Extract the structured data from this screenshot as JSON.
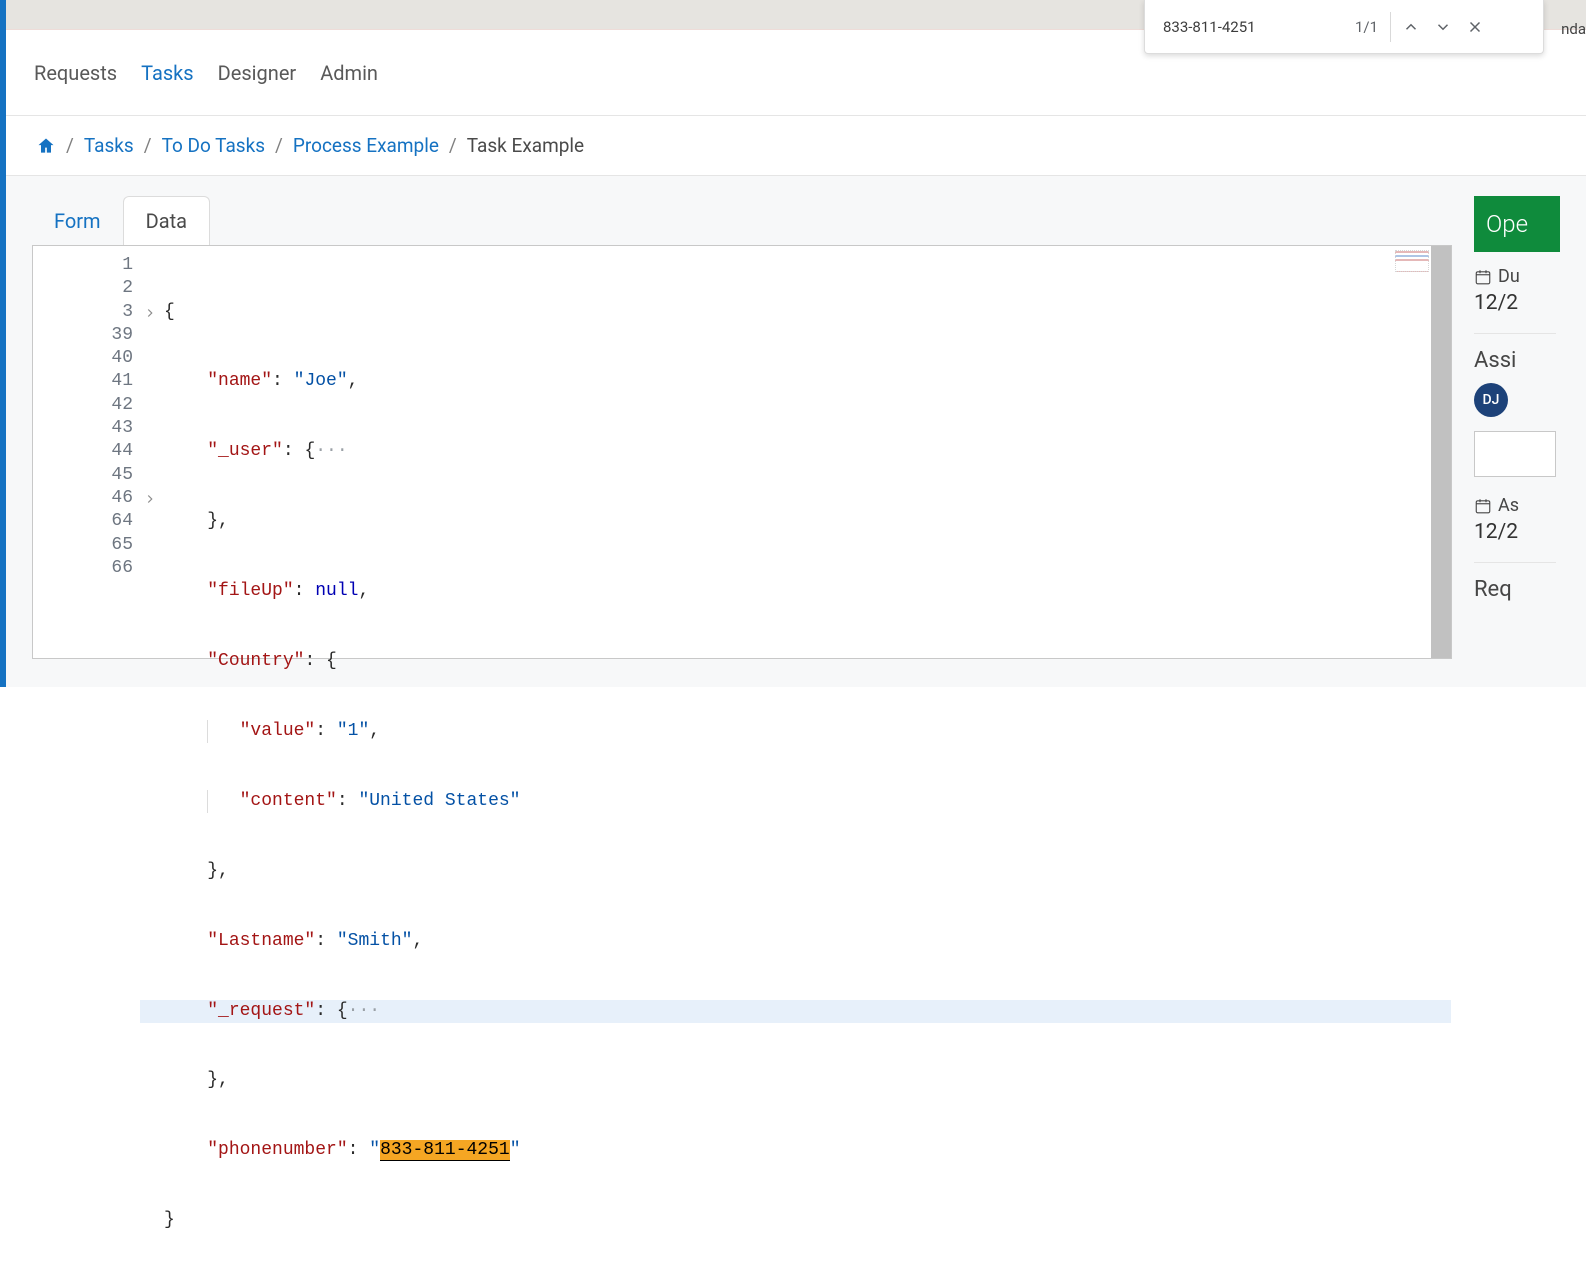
{
  "find": {
    "query": "833-811-4251",
    "count": "1/1"
  },
  "nav": {
    "requests": "Requests",
    "tasks": "Tasks",
    "designer": "Designer",
    "admin": "Admin"
  },
  "page_hint": "nda",
  "breadcrumb": {
    "tasks": "Tasks",
    "todo": "To Do Tasks",
    "process": "Process Example",
    "current": "Task Example"
  },
  "tabs": {
    "form": "Form",
    "data": "Data"
  },
  "code": {
    "lines": [
      "1",
      "2",
      "3",
      "39",
      "40",
      "41",
      "42",
      "43",
      "44",
      "45",
      "46",
      "64",
      "65",
      "66"
    ],
    "fold_line_indexes": [
      2,
      10
    ],
    "rows": {
      "r1": "{",
      "name_key": "\"name\"",
      "name_val": "\"Joe\"",
      "user_key": "\"_user\"",
      "fileup_key": "\"fileUp\"",
      "fileup_val": "null",
      "country_key": "\"Country\"",
      "value_key": "\"value\"",
      "value_val": "\"1\"",
      "content_key": "\"content\"",
      "content_val": "\"United States\"",
      "lastname_key": "\"Lastname\"",
      "lastname_val": "\"Smith\"",
      "request_key": "\"_request\"",
      "phone_key": "\"phonenumber\"",
      "phone_val": "833-811-4251",
      "ellipsis": "···"
    }
  },
  "side": {
    "status": "Ope",
    "due_label": "Du",
    "due_value": "12/2",
    "assigned_label": "Assi",
    "avatar": "DJ",
    "assigned_date_label": "As",
    "assigned_date_value": "12/2",
    "request_label": "Req"
  }
}
